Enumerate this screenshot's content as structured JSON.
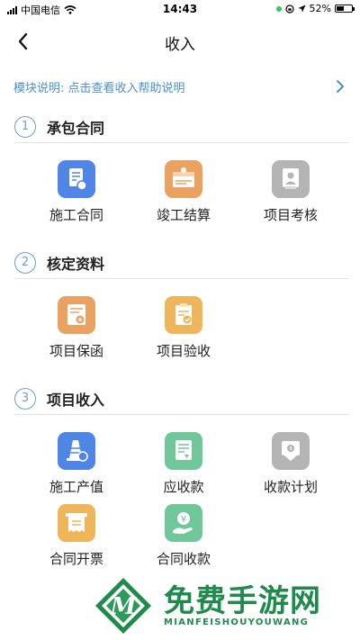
{
  "status_bar": {
    "carrier": "中国电信",
    "time": "14:43",
    "battery_percent": "52%",
    "wifi_icon": "wifi-icon",
    "location_icon": "location-arrow-icon",
    "lock_icon": "rotation-lock-icon"
  },
  "nav": {
    "title": "收入",
    "back_icon": "back-chevron-icon"
  },
  "help": {
    "text": "模块说明: 点击查看收入帮助说明",
    "arrow_icon": "chevron-right-icon"
  },
  "sections": [
    {
      "number": "1",
      "title": "承包合同",
      "items": [
        {
          "label": "施工合同",
          "icon": "contract-document-icon",
          "color": "#4f86e6"
        },
        {
          "label": "竣工结算",
          "icon": "settlement-invoice-icon",
          "color": "#e9a25f"
        },
        {
          "label": "项目考核",
          "icon": "assessment-badge-icon",
          "color": "#b4b4b4"
        }
      ]
    },
    {
      "number": "2",
      "title": "核定资料",
      "items": [
        {
          "label": "项目保函",
          "icon": "guarantee-certificate-icon",
          "color": "#e9a25f"
        },
        {
          "label": "项目验收",
          "icon": "acceptance-clipboard-icon",
          "color": "#efb55a"
        }
      ]
    },
    {
      "number": "3",
      "title": "项目收入",
      "items": [
        {
          "label": "施工产值",
          "icon": "output-value-icon",
          "color": "#4f86e6"
        },
        {
          "label": "应收款",
          "icon": "receivable-document-icon",
          "color": "#6fc79a"
        },
        {
          "label": "收款计划",
          "icon": "collection-plan-icon",
          "color": "#b4b4b4"
        },
        {
          "label": "合同开票",
          "icon": "invoice-receipt-icon",
          "color": "#efb55a"
        },
        {
          "label": "合同收款",
          "icon": "payment-received-icon",
          "color": "#6fc79a"
        }
      ]
    }
  ],
  "watermark": {
    "title": "免费手游网",
    "subtitle": "MIANFEISHOUYOUWANG",
    "logo_letter": "M"
  }
}
